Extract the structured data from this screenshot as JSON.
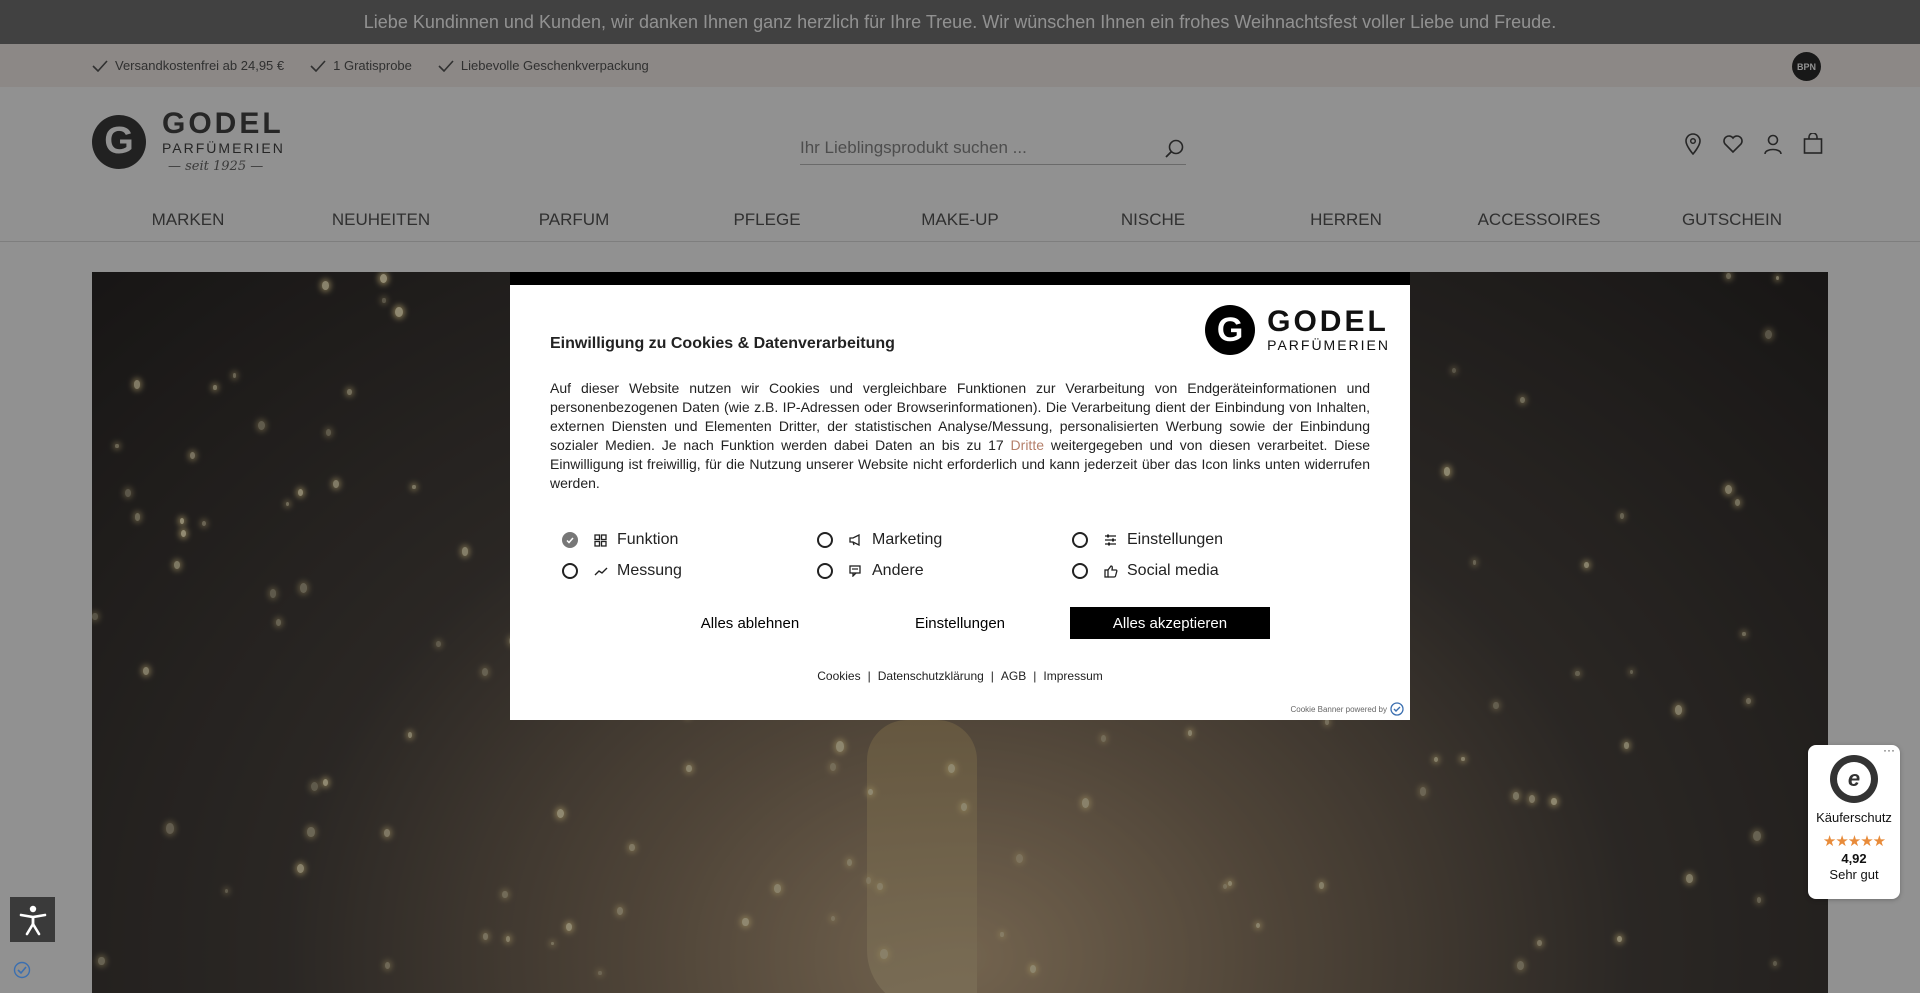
{
  "announcement": "Liebe Kundinnen und Kunden, wir danken Ihnen ganz herzlich für Ihre Treue. Wir wünschen Ihnen ein frohes Weihnachtsfest voller Liebe und Freude.",
  "usps": [
    {
      "label": "Versandkostenfrei ab 24,95 €",
      "icon": "check-icon"
    },
    {
      "label": "1 Gratisprobe",
      "icon": "check-icon"
    },
    {
      "label": "Liebevolle Geschenkverpackung",
      "icon": "check-icon"
    }
  ],
  "bpn_badge": "BPN",
  "logo": {
    "mark": "G",
    "brand": "GODEL",
    "sub": "PARFÜMERIEN",
    "since": "— seit 1925 —"
  },
  "search": {
    "placeholder": "Ihr Lieblingsprodukt suchen ...",
    "value": ""
  },
  "header_icons": [
    "location-pin-icon",
    "heart-icon",
    "user-icon",
    "shopping-bag-icon"
  ],
  "nav": [
    "MARKEN",
    "NEUHEITEN",
    "PARFUM",
    "PFLEGE",
    "MAKE-UP",
    "NISCHE",
    "HERREN",
    "ACCESSOIRES",
    "GUTSCHEIN"
  ],
  "cookie_modal": {
    "logo_mark": "G",
    "logo_brand": "GODEL",
    "logo_sub": "PARFÜMERIEN",
    "title": "Einwilligung zu Cookies & Datenverarbeitung",
    "desc_before": "Auf dieser Website nutzen wir Cookies und vergleichbare Funktionen zur Verarbeitung von Endgeräteinformationen und personenbezogenen Daten (wie z.B. IP-Adressen oder Browserinformationen). Die Verarbeitung dient der Einbindung von Inhalten, externen Diensten und Elementen Dritter, der statistischen Analyse/Messung, personalisierten Werbung sowie der Einbindung sozialer Medien. Je nach Funktion werden dabei Daten an bis zu 17 ",
    "desc_link": "Dritte",
    "desc_after": " weitergegeben und von diesen verarbeitet. Diese Einwilligung ist freiwillig, für die Nutzung unserer Website nicht erforderlich und kann jederzeit über das Icon links unten widerrufen werden.",
    "options": [
      {
        "label": "Funktion",
        "checked": true,
        "icon": "puzzle-icon"
      },
      {
        "label": "Marketing",
        "checked": false,
        "icon": "megaphone-icon"
      },
      {
        "label": "Einstellungen",
        "checked": false,
        "icon": "sliders-icon"
      },
      {
        "label": "Messung",
        "checked": false,
        "icon": "trend-icon"
      },
      {
        "label": "Andere",
        "checked": false,
        "icon": "chat-icon"
      },
      {
        "label": "Social media",
        "checked": false,
        "icon": "thumbs-up-icon"
      }
    ],
    "btn_reject": "Alles ablehnen",
    "btn_settings": "Einstellungen",
    "btn_accept": "Alles akzeptieren",
    "links": [
      "Cookies",
      "Datenschutzklärung",
      "AGB",
      "Impressum"
    ],
    "separator": "|",
    "powered_by": "Cookie Banner powered by"
  },
  "trusted_shops": {
    "more": "···",
    "seal": "e",
    "label": "Käuferschutz",
    "stars": "★★★★★",
    "rating": "4,92",
    "verdict": "Sehr gut"
  }
}
